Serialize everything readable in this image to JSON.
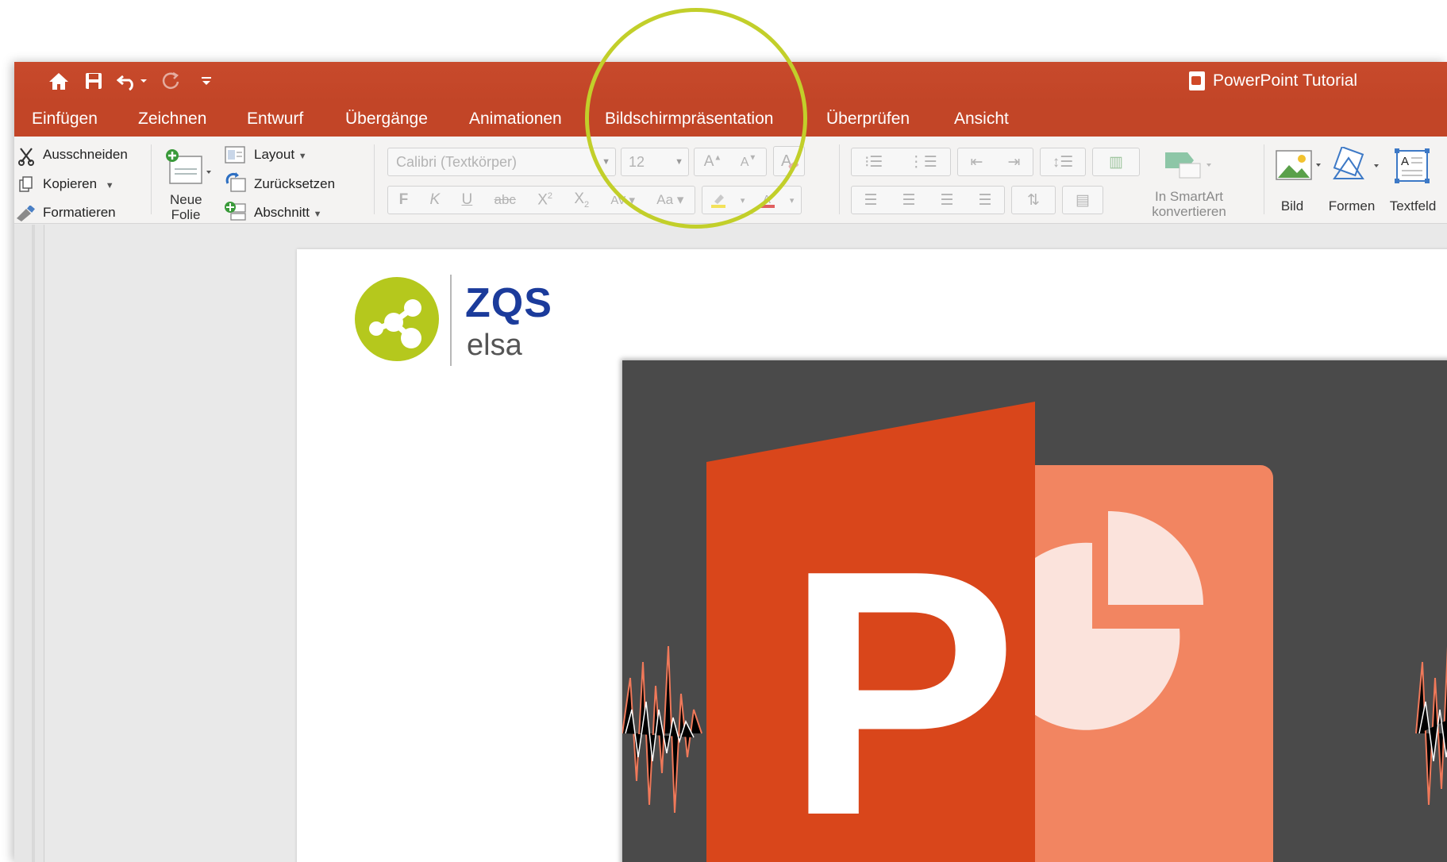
{
  "window": {
    "title": "PowerPoint Tutorial"
  },
  "quick_access": {
    "home_icon": "home-icon",
    "save_icon": "save-icon",
    "undo_icon": "undo-icon",
    "redo_icon": "redo-icon",
    "customize_icon": "customize-toolbar-icon"
  },
  "tabs": [
    "Einfügen",
    "Zeichnen",
    "Entwurf",
    "Übergänge",
    "Animationen",
    "Bildschirmpräsentation",
    "Überprüfen",
    "Ansicht"
  ],
  "clipboard": {
    "cut": "Ausschneiden",
    "copy": "Kopieren",
    "format": "Formatieren"
  },
  "slides": {
    "new_slide_line1": "Neue",
    "new_slide_line2": "Folie",
    "layout": "Layout",
    "reset": "Zurücksetzen",
    "section": "Abschnitt"
  },
  "font": {
    "name_placeholder": "Calibri (Textkörper)",
    "size": "12",
    "grow": "A",
    "shrink": "A",
    "bold": "F",
    "italic": "K",
    "underline": "U",
    "strikethrough": "abc",
    "superscript": "X",
    "subscript": "X",
    "spacing": "AV",
    "case": "Aa"
  },
  "smartart": {
    "line1": "In SmartArt",
    "line2": "konvertieren"
  },
  "insert": {
    "picture": "Bild",
    "shapes": "Formen",
    "textbox": "Textfeld"
  },
  "slide_content": {
    "logo_brand": "ZQS",
    "logo_sub": "elsa",
    "ppt_letter": "P"
  },
  "colors": {
    "titlebar": "#c24527",
    "ribbon_bg": "#f4f3f2",
    "highlight_ring": "#c2cf2a",
    "ppt_dark": "#d9461b",
    "ppt_light": "#f28561",
    "logo_green": "#b5c81d",
    "logo_blue": "#1b3b9b"
  }
}
